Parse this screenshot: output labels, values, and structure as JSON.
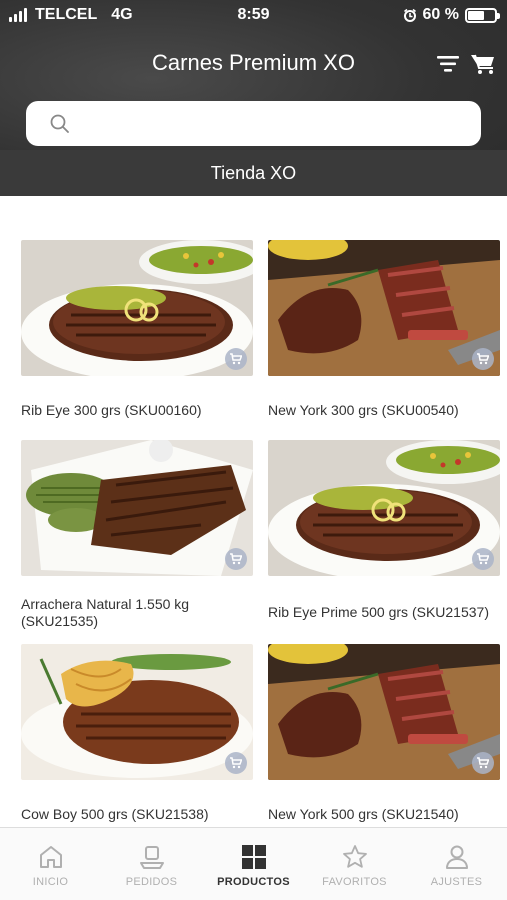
{
  "status_bar": {
    "carrier": "TELCEL",
    "network": "4G",
    "time": "8:59",
    "battery": "60 %",
    "battery_level": 0.6
  },
  "header": {
    "title": "Carnes Premium XO",
    "filter_icon": "filter-icon",
    "cart_icon": "cart-icon"
  },
  "search": {
    "placeholder": "",
    "value": ""
  },
  "store": {
    "name": "Tienda XO"
  },
  "products": [
    {
      "name": "Rib Eye 300 grs (SKU00160)",
      "image": "ribeye"
    },
    {
      "name": "New York 300 grs (SKU00540)",
      "image": "newyork"
    },
    {
      "name": "Arrachera Natural 1.550 kg (SKU21535)",
      "image": "arrachera"
    },
    {
      "name": "Rib Eye Prime 500 grs (SKU21537)",
      "image": "ribeye"
    },
    {
      "name": "Cow Boy 500 grs (SKU21538)",
      "image": "cowboy"
    },
    {
      "name": "New York 500 grs (SKU21540)",
      "image": "newyork"
    }
  ],
  "tabs": [
    {
      "label": "INICIO",
      "icon": "home-icon",
      "active": false
    },
    {
      "label": "PEDIDOS",
      "icon": "orders-icon",
      "active": false
    },
    {
      "label": "PRODUCTOS",
      "icon": "grid-icon",
      "active": true
    },
    {
      "label": "FAVORITOS",
      "icon": "star-icon",
      "active": false
    },
    {
      "label": "AJUSTES",
      "icon": "user-icon",
      "active": false
    }
  ],
  "colors": {
    "header_bg": "#333333",
    "tab_active": "#333333",
    "tab_inactive": "#b0b0b0"
  }
}
